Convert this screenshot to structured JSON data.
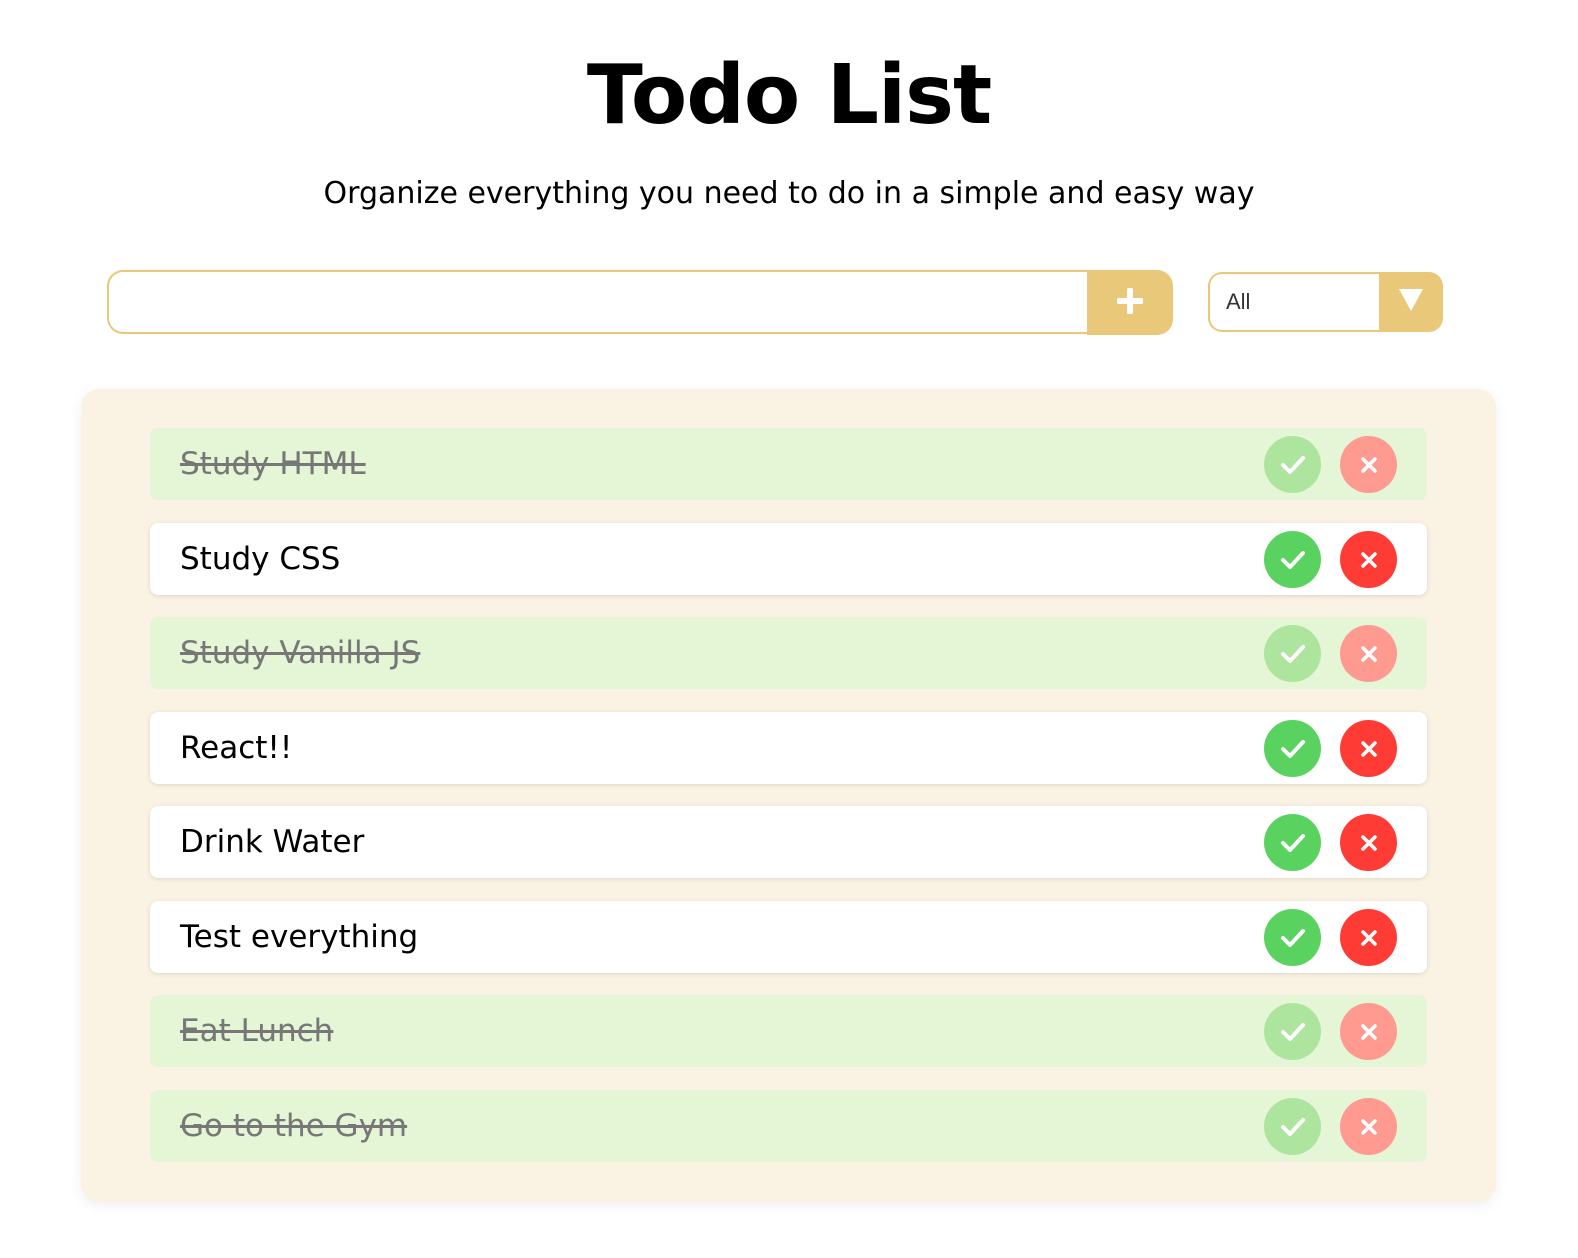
{
  "header": {
    "title": "Todo List",
    "subtitle": "Organize everything you need to do in a simple and easy way"
  },
  "add_form": {
    "input_value": "",
    "input_placeholder": "",
    "add_icon": "plus-icon"
  },
  "filter": {
    "selected": "All",
    "arrow_icon": "triangle-down-icon"
  },
  "todos": [
    {
      "text": "Study HTML",
      "completed": true
    },
    {
      "text": "Study CSS",
      "completed": false
    },
    {
      "text": "Study Vanilla JS",
      "completed": true
    },
    {
      "text": "React!!",
      "completed": false
    },
    {
      "text": "Drink Water",
      "completed": false
    },
    {
      "text": "Test everything",
      "completed": false
    },
    {
      "text": "Eat Lunch",
      "completed": true
    },
    {
      "text": "Go to the Gym",
      "completed": true
    }
  ],
  "item_icons": {
    "complete": "check-icon",
    "delete": "close-icon"
  },
  "colors": {
    "accent": "#e9c87a",
    "panel_background": "#faf2e2",
    "completed_row": "#e4f6d6",
    "check_green": "#5ad25f",
    "delete_red": "#ff3b35"
  }
}
